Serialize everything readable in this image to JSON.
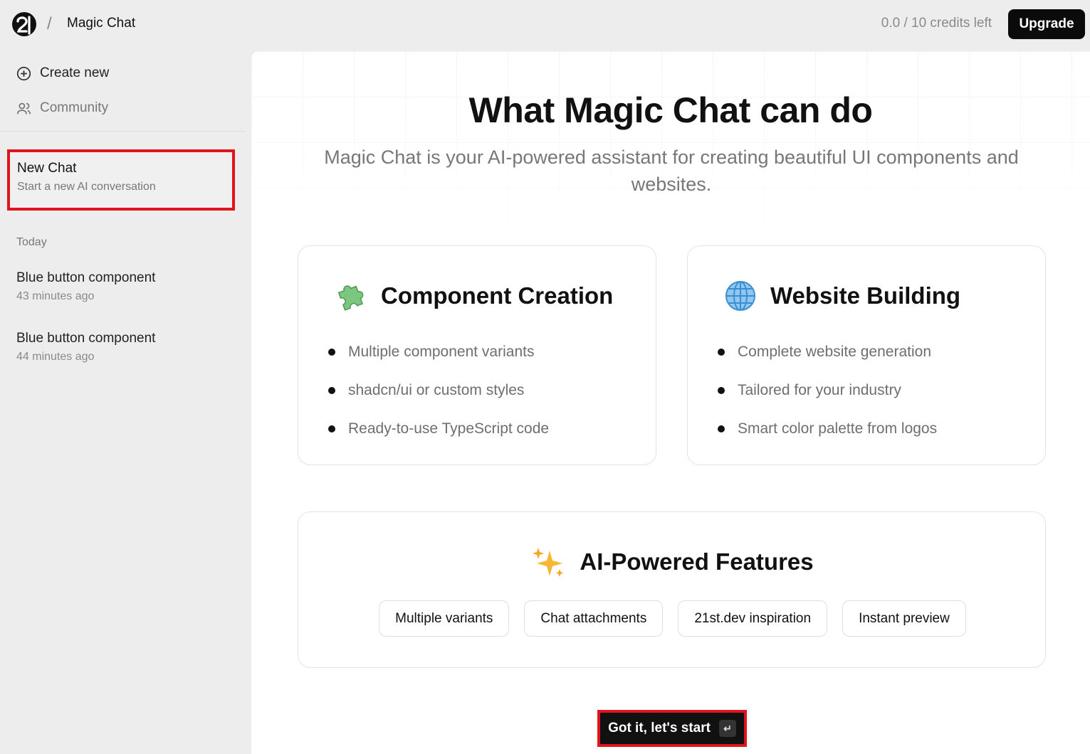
{
  "header": {
    "app_title": "Magic Chat",
    "separator": "/",
    "credits": "0.0 / 10 credits left",
    "upgrade_label": "Upgrade"
  },
  "sidebar": {
    "nav": [
      {
        "label": "Create new",
        "icon": "plus-circle-icon"
      },
      {
        "label": "Community",
        "icon": "users-icon"
      }
    ],
    "new_chat": {
      "title": "New Chat",
      "subtitle": "Start a new AI conversation"
    },
    "section_label": "Today",
    "chats": [
      {
        "title": "Blue button component",
        "time": "43 minutes ago"
      },
      {
        "title": "Blue button component",
        "time": "44 minutes ago"
      }
    ]
  },
  "main": {
    "heading": "What Magic Chat can do",
    "subheading": "Magic Chat is your AI-powered assistant for creating beautiful UI components and websites.",
    "cards": [
      {
        "title": "Component Creation",
        "icon": "puzzle-icon",
        "items": [
          "Multiple component variants",
          "shadcn/ui or custom styles",
          "Ready-to-use TypeScript code"
        ]
      },
      {
        "title": "Website Building",
        "icon": "globe-icon",
        "items": [
          "Complete website generation",
          "Tailored for your industry",
          "Smart color palette from logos"
        ]
      }
    ],
    "ai_features": {
      "title": "AI-Powered Features",
      "icon": "sparkles-icon",
      "chips": [
        "Multiple variants",
        "Chat attachments",
        "21st.dev inspiration",
        "Instant preview"
      ]
    },
    "start_button": {
      "label": "Got it, let's start",
      "key_hint": "↵"
    }
  },
  "colors": {
    "highlight": "#e0141c",
    "accent": "#0b0b0b"
  }
}
